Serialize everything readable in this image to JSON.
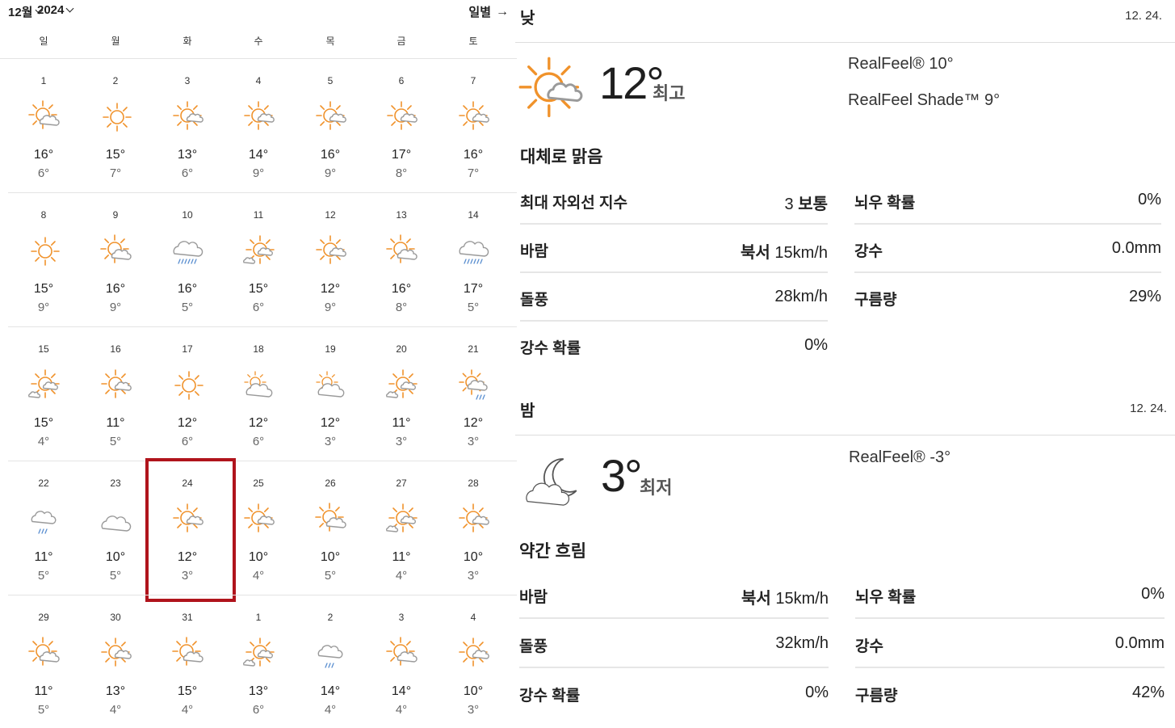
{
  "calendar": {
    "month": "12월",
    "year": "2024",
    "view": "일별",
    "weekdays": [
      "일",
      "월",
      "화",
      "수",
      "목",
      "금",
      "토"
    ],
    "weeks": [
      [
        {
          "d": "1",
          "hi": "16°",
          "lo": "6°",
          "icon": "partly-sunny-icon"
        },
        {
          "d": "2",
          "hi": "15°",
          "lo": "7°",
          "icon": "sunny-icon"
        },
        {
          "d": "3",
          "hi": "13°",
          "lo": "6°",
          "icon": "mostly-sunny-icon"
        },
        {
          "d": "4",
          "hi": "14°",
          "lo": "9°",
          "icon": "mostly-sunny-icon"
        },
        {
          "d": "5",
          "hi": "16°",
          "lo": "9°",
          "icon": "mostly-sunny-icon"
        },
        {
          "d": "6",
          "hi": "17°",
          "lo": "8°",
          "icon": "mostly-sunny-icon"
        },
        {
          "d": "7",
          "hi": "16°",
          "lo": "7°",
          "icon": "mostly-sunny-icon"
        }
      ],
      [
        {
          "d": "8",
          "hi": "15°",
          "lo": "9°",
          "icon": "sunny-icon"
        },
        {
          "d": "9",
          "hi": "16°",
          "lo": "9°",
          "icon": "partly-sunny-icon"
        },
        {
          "d": "10",
          "hi": "16°",
          "lo": "5°",
          "icon": "rain-icon"
        },
        {
          "d": "11",
          "hi": "15°",
          "lo": "6°",
          "icon": "hazy-sunshine-icon"
        },
        {
          "d": "12",
          "hi": "12°",
          "lo": "9°",
          "icon": "mostly-sunny-icon"
        },
        {
          "d": "13",
          "hi": "16°",
          "lo": "8°",
          "icon": "partly-sunny-icon"
        },
        {
          "d": "14",
          "hi": "17°",
          "lo": "5°",
          "icon": "rain-icon"
        }
      ],
      [
        {
          "d": "15",
          "hi": "15°",
          "lo": "4°",
          "icon": "hazy-sunshine-icon"
        },
        {
          "d": "16",
          "hi": "11°",
          "lo": "5°",
          "icon": "mostly-sunny-icon"
        },
        {
          "d": "17",
          "hi": "12°",
          "lo": "6°",
          "icon": "sunny-icon"
        },
        {
          "d": "18",
          "hi": "12°",
          "lo": "6°",
          "icon": "mostly-cloudy-icon"
        },
        {
          "d": "19",
          "hi": "12°",
          "lo": "3°",
          "icon": "mostly-cloudy-icon"
        },
        {
          "d": "20",
          "hi": "11°",
          "lo": "3°",
          "icon": "hazy-sunshine-icon"
        },
        {
          "d": "21",
          "hi": "12°",
          "lo": "3°",
          "icon": "sun-showers-icon"
        }
      ],
      [
        {
          "d": "22",
          "hi": "11°",
          "lo": "5°",
          "icon": "showers-icon"
        },
        {
          "d": "23",
          "hi": "10°",
          "lo": "5°",
          "icon": "cloudy-icon"
        },
        {
          "d": "24",
          "hi": "12°",
          "lo": "3°",
          "icon": "mostly-sunny-icon",
          "selected": true
        },
        {
          "d": "25",
          "hi": "10°",
          "lo": "4°",
          "icon": "mostly-sunny-icon"
        },
        {
          "d": "26",
          "hi": "10°",
          "lo": "5°",
          "icon": "partly-sunny-icon"
        },
        {
          "d": "27",
          "hi": "11°",
          "lo": "4°",
          "icon": "hazy-sunshine-icon"
        },
        {
          "d": "28",
          "hi": "10°",
          "lo": "3°",
          "icon": "mostly-sunny-icon"
        }
      ],
      [
        {
          "d": "29",
          "hi": "11°",
          "lo": "5°",
          "icon": "partly-sunny-icon"
        },
        {
          "d": "30",
          "hi": "13°",
          "lo": "4°",
          "icon": "mostly-sunny-icon"
        },
        {
          "d": "31",
          "hi": "15°",
          "lo": "4°",
          "icon": "partly-sunny-icon"
        },
        {
          "d": "1",
          "hi": "13°",
          "lo": "6°",
          "icon": "hazy-sunshine-icon"
        },
        {
          "d": "2",
          "hi": "14°",
          "lo": "4°",
          "icon": "showers-icon"
        },
        {
          "d": "3",
          "hi": "14°",
          "lo": "4°",
          "icon": "partly-sunny-icon"
        },
        {
          "d": "4",
          "hi": "10°",
          "lo": "3°",
          "icon": "mostly-sunny-icon"
        }
      ]
    ]
  },
  "day": {
    "title": "낮",
    "date": "12. 24.",
    "icon": "mostly-sunny-icon",
    "temp": "12°",
    "temp_label": "최고",
    "realfeel": "RealFeel® 10°",
    "realfeel_shade": "RealFeel Shade™ 9°",
    "condition": "대체로 맑음",
    "left": [
      {
        "label": "최대 자외선 지수",
        "value_plain": "3 ",
        "value_bold": "보통"
      },
      {
        "label": "바람",
        "value_bold": "북서",
        "value_plain": " 15km/h"
      },
      {
        "label": "돌풍",
        "value_plain": "28km/h"
      },
      {
        "label": "강수 확률",
        "value_plain": "0%"
      }
    ],
    "right": [
      {
        "label": "뇌우 확률",
        "value_plain": "0%"
      },
      {
        "label": "강수",
        "value_plain": "0.0mm"
      },
      {
        "label": "구름량",
        "value_plain": "29%"
      }
    ]
  },
  "night": {
    "title": "밤",
    "date": "12. 24.",
    "icon": "partly-cloudy-night-icon",
    "temp": "3°",
    "temp_label": "최저",
    "realfeel": "RealFeel® -3°",
    "condition": "약간 흐림",
    "left": [
      {
        "label": "바람",
        "value_bold": "북서",
        "value_plain": " 15km/h"
      },
      {
        "label": "돌풍",
        "value_plain": "32km/h"
      },
      {
        "label": "강수 확률",
        "value_plain": "0%"
      }
    ],
    "right": [
      {
        "label": "뇌우 확률",
        "value_plain": "0%"
      },
      {
        "label": "강수",
        "value_plain": "0.0mm"
      },
      {
        "label": "구름량",
        "value_plain": "42%"
      }
    ]
  },
  "colors": {
    "sun": "#f0922b",
    "cloud": "#9a9a9a",
    "rain": "#5a8fd0",
    "select": "#b0141c"
  }
}
